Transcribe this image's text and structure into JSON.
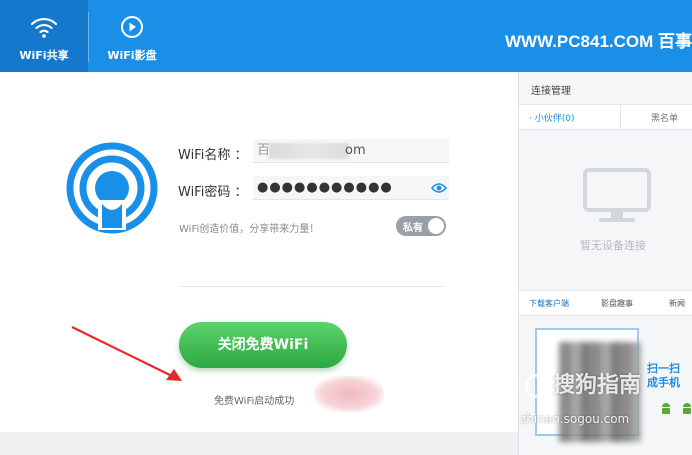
{
  "header": {
    "tabs": [
      {
        "label": "WiFi共享",
        "icon": "wifi-icon"
      },
      {
        "label": "WiFi影盘",
        "icon": "play-circle-icon"
      }
    ],
    "site_text": "WWW.PC841.COM 百事"
  },
  "form": {
    "name_label": "WiFi名称 ：",
    "name_value_suffix": "om",
    "password_label": "WiFi密码 ：",
    "password_value": "●●●●●●●●●●●",
    "slogan": "WiFi创造价值，分享带来力量！",
    "toggle_label": "私有"
  },
  "action": {
    "close_wifi_label": "关闭免费WiFi",
    "status_text": "免费WiFi启动成功"
  },
  "right_panel": {
    "title": "连接管理",
    "tabs": [
      "· 小伙伴(0)",
      "黑名单"
    ],
    "empty_text": "暂无设备连接",
    "bottom_tabs": [
      "下载客户端",
      "影盘趣事",
      "新闻"
    ],
    "scan_text_1": "扫一扫",
    "scan_text_2": "成手机"
  },
  "watermark": {
    "text": "搜狗指南",
    "url": "zhinan.sogou.com"
  },
  "colors": {
    "header_blue": "#1a8fe8",
    "button_green": "#3dbb52",
    "arrow_red": "#e8282b"
  }
}
